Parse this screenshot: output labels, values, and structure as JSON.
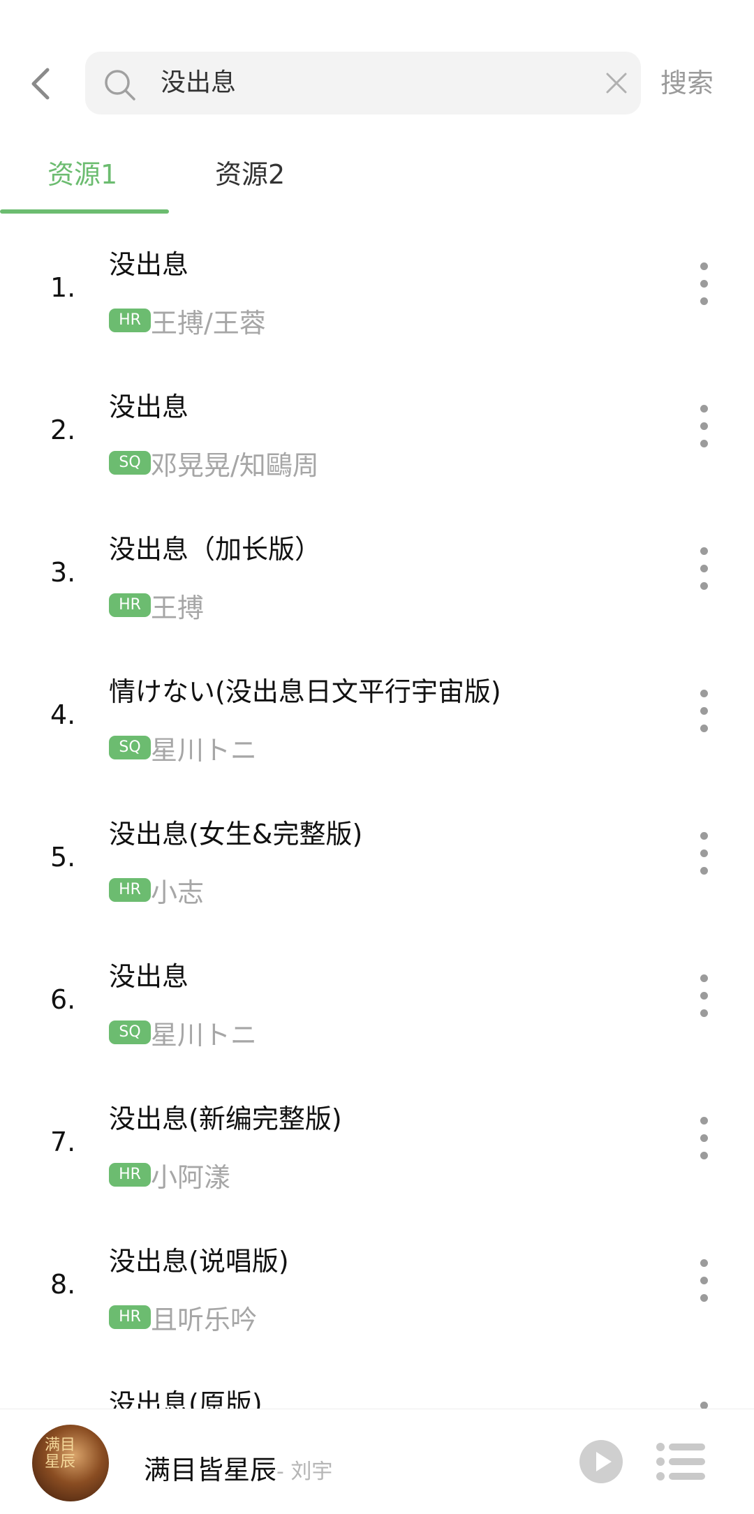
{
  "search": {
    "query": "没出息",
    "submit_label": "搜索"
  },
  "tabs": [
    {
      "label": "资源1",
      "active": true
    },
    {
      "label": "资源2",
      "active": false
    }
  ],
  "songs": [
    {
      "index": "1.",
      "title": "没出息",
      "quality": "HR",
      "artist": "王搏/王蓉"
    },
    {
      "index": "2.",
      "title": "没出息",
      "quality": "SQ",
      "artist": "邓晃晃/知鷗周"
    },
    {
      "index": "3.",
      "title": "没出息（加长版）",
      "quality": "HR",
      "artist": "王搏"
    },
    {
      "index": "4.",
      "title": "情けない(没出息日文平行宇宙版)",
      "quality": "SQ",
      "artist": "星川トニ"
    },
    {
      "index": "5.",
      "title": "没出息(女生&完整版)",
      "quality": "HR",
      "artist": "小志"
    },
    {
      "index": "6.",
      "title": "没出息",
      "quality": "SQ",
      "artist": "星川トニ"
    },
    {
      "index": "7.",
      "title": "没出息(新编完整版)",
      "quality": "HR",
      "artist": "小阿漾"
    },
    {
      "index": "8.",
      "title": "没出息(说唱版)",
      "quality": "HR",
      "artist": "且听乐吟"
    },
    {
      "index": "",
      "title": "没出息(原版)",
      "quality": "",
      "artist": ""
    }
  ],
  "now_playing": {
    "title": "满目皆星辰",
    "artist": "- 刘宇",
    "cover_text": "满目\n星辰"
  },
  "colors": {
    "accent": "#6cbc70",
    "muted": "#a6a6a6"
  },
  "icons": [
    "back-icon",
    "search-icon",
    "clear-icon",
    "more-icon",
    "play-icon",
    "playlist-icon"
  ]
}
